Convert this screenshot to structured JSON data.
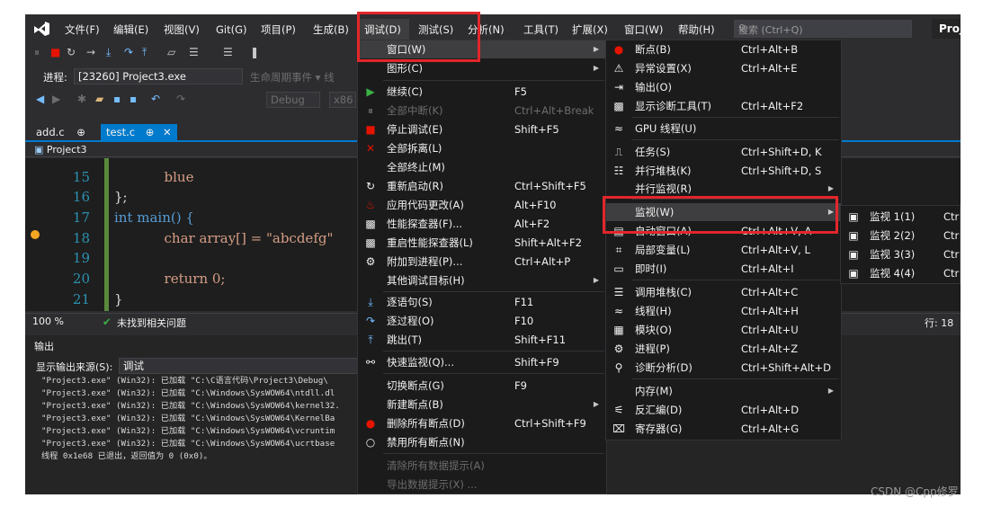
{
  "menubar": {
    "items": [
      "文件(F)",
      "编辑(E)",
      "视图(V)",
      "Git(G)",
      "项目(P)",
      "生成(B)",
      "调试(D)",
      "测试(S)",
      "分析(N)",
      "工具(T)",
      "扩展(X)",
      "窗口(W)",
      "帮助(H)"
    ],
    "search_placeholder": "搜索 (Ctrl+Q)",
    "project_label": "Proj"
  },
  "toolbar2": {
    "process_label": "进程:",
    "process_value": "[23260] Project3.exe",
    "lifecycle_label": "生命周期事件 ▾ 线"
  },
  "toolbar3": {
    "config_value": "Debug",
    "platform_value": "x86"
  },
  "tabs": [
    {
      "label": "add.c",
      "pin": "⊕"
    },
    {
      "label": "test.c",
      "pin": "⊕"
    }
  ],
  "editor": {
    "nav_project": "Project3",
    "lines": [
      {
        "n": "15",
        "code": "  blue"
      },
      {
        "n": "16",
        "code": "};"
      },
      {
        "n": "17",
        "code": "int main() {"
      },
      {
        "n": "18",
        "code": "  char array[] = \"abcdefg\""
      },
      {
        "n": "19",
        "code": ""
      },
      {
        "n": "20",
        "code": "  return 0;"
      },
      {
        "n": "21",
        "code": "}"
      }
    ]
  },
  "statusbar": {
    "zoom": "100 %",
    "issues": "未找到相关问题",
    "line": "行: 18"
  },
  "output": {
    "title": "输出",
    "source_label": "显示输出来源(S):",
    "source_value": "调试",
    "lines": [
      "\"Project3.exe\" (Win32): 已加载 \"C:\\C语言代码\\Project3\\Debug\\",
      "\"Project3.exe\" (Win32): 已加载 \"C:\\Windows\\SysWOW64\\ntdll.dl",
      "\"Project3.exe\" (Win32): 已加载 \"C:\\Windows\\SysWOW64\\kernel32.",
      "\"Project3.exe\" (Win32): 已加载 \"C:\\Windows\\SysWOW64\\KernelBa",
      "\"Project3.exe\" (Win32): 已加载 \"C:\\Windows\\SysWOW64\\vcruntim",
      "\"Project3.exe\" (Win32): 已加载 \"C:\\Windows\\SysWOW64\\ucrtbase",
      "线程 0x1e68 已退出，返回值为 0 (0x0)。"
    ]
  },
  "debug_menu": [
    {
      "label": "窗口(W)",
      "shortcut": "",
      "icon": "",
      "submenu": true
    },
    {
      "label": "图形(C)",
      "shortcut": "",
      "icon": "",
      "submenu": true
    },
    {
      "label": "继续(C)",
      "shortcut": "F5",
      "icon": "play-icon"
    },
    {
      "label": "全部中断(K)",
      "shortcut": "Ctrl+Alt+Break",
      "icon": "pause-icon",
      "disabled": true
    },
    {
      "label": "停止调试(E)",
      "shortcut": "Shift+F5",
      "icon": "stop-icon"
    },
    {
      "label": "全部拆离(L)",
      "shortcut": "",
      "icon": "close-icon"
    },
    {
      "label": "全部终止(M)",
      "shortcut": "",
      "icon": ""
    },
    {
      "label": "重新启动(R)",
      "shortcut": "Ctrl+Shift+F5",
      "icon": "restart-icon"
    },
    {
      "label": "应用代码更改(A)",
      "shortcut": "Alt+F10",
      "icon": "flame-icon"
    },
    {
      "label": "性能探查器(F)...",
      "shortcut": "Alt+F2",
      "icon": "profiler-icon"
    },
    {
      "label": "重启性能探查器(L)",
      "shortcut": "Shift+Alt+F2",
      "icon": "profiler-icon"
    },
    {
      "label": "附加到进程(P)...",
      "shortcut": "Ctrl+Alt+P",
      "icon": "gear-icon"
    },
    {
      "label": "其他调试目标(H)",
      "shortcut": "",
      "icon": "",
      "submenu": true
    },
    {
      "label": "逐语句(S)",
      "shortcut": "F11",
      "icon": "step-into-icon"
    },
    {
      "label": "逐过程(O)",
      "shortcut": "F10",
      "icon": "step-over-icon"
    },
    {
      "label": "跳出(T)",
      "shortcut": "Shift+F11",
      "icon": "step-out-icon"
    },
    {
      "label": "快速监视(Q)...",
      "shortcut": "Shift+F9",
      "icon": "glasses-icon"
    },
    {
      "label": "切换断点(G)",
      "shortcut": "F9",
      "icon": ""
    },
    {
      "label": "新建断点(B)",
      "shortcut": "",
      "icon": "",
      "submenu": true
    },
    {
      "label": "删除所有断点(D)",
      "shortcut": "Ctrl+Shift+F9",
      "icon": "delete-breakpoints-icon"
    },
    {
      "label": "禁用所有断点(N)",
      "shortcut": "",
      "icon": "disable-breakpoints-icon"
    },
    {
      "label": "清除所有数据提示(A)",
      "shortcut": "",
      "icon": "",
      "disabled": true
    },
    {
      "label": "导出数据提示(X) ...",
      "shortcut": "",
      "icon": "",
      "disabled": true
    }
  ],
  "window_menu": [
    {
      "label": "断点(B)",
      "shortcut": "Ctrl+Alt+B",
      "icon": "breakpoint-icon"
    },
    {
      "label": "异常设置(X)",
      "shortcut": "Ctrl+Alt+E",
      "icon": "exception-icon"
    },
    {
      "label": "输出(O)",
      "shortcut": "",
      "icon": "output-icon"
    },
    {
      "label": "显示诊断工具(T)",
      "shortcut": "Ctrl+Alt+F2",
      "icon": "diagnostics-icon"
    },
    {
      "label": "GPU 线程(U)",
      "shortcut": "",
      "icon": "gpu-threads-icon"
    },
    {
      "label": "任务(S)",
      "shortcut": "Ctrl+Shift+D, K",
      "icon": "tasks-icon"
    },
    {
      "label": "并行堆栈(K)",
      "shortcut": "Ctrl+Shift+D, S",
      "icon": "parallel-stacks-icon"
    },
    {
      "label": "并行监视(R)",
      "shortcut": "",
      "icon": "",
      "submenu": true
    },
    {
      "label": "监视(W)",
      "shortcut": "",
      "icon": "",
      "submenu": true
    },
    {
      "label": "自动窗口(A)",
      "shortcut": "Ctrl+Alt+V, A",
      "icon": "autos-icon"
    },
    {
      "label": "局部变量(L)",
      "shortcut": "Ctrl+Alt+V, L",
      "icon": "locals-icon"
    },
    {
      "label": "即时(I)",
      "shortcut": "Ctrl+Alt+I",
      "icon": "immediate-icon"
    },
    {
      "label": "调用堆栈(C)",
      "shortcut": "Ctrl+Alt+C",
      "icon": "call-stack-icon"
    },
    {
      "label": "线程(H)",
      "shortcut": "Ctrl+Alt+H",
      "icon": "threads-icon"
    },
    {
      "label": "模块(O)",
      "shortcut": "Ctrl+Alt+U",
      "icon": "modules-icon"
    },
    {
      "label": "进程(P)",
      "shortcut": "Ctrl+Alt+Z",
      "icon": "processes-icon"
    },
    {
      "label": "诊断分析(D)",
      "shortcut": "Ctrl+Shift+Alt+D",
      "icon": "diagnostic-analysis-icon"
    },
    {
      "label": "内存(M)",
      "shortcut": "",
      "icon": "",
      "submenu": true
    },
    {
      "label": "反汇编(D)",
      "shortcut": "Ctrl+Alt+D",
      "icon": "disassembly-icon"
    },
    {
      "label": "寄存器(G)",
      "shortcut": "Ctrl+Alt+G",
      "icon": "registers-icon"
    }
  ],
  "watch_menu": [
    {
      "label": "监视 1(1)",
      "shortcut": "Ctr"
    },
    {
      "label": "监视 2(2)",
      "shortcut": "Ctr"
    },
    {
      "label": "监视 3(3)",
      "shortcut": "Ctr"
    },
    {
      "label": "监视 4(4)",
      "shortcut": "Ctr"
    }
  ],
  "watermark": "CSDN @Cpp修罗",
  "colors": {
    "accent": "#007acc",
    "highlight_box": "#e3262a",
    "menu_bg": "#1b1b1c",
    "chrome_bg": "#2d2d30"
  }
}
